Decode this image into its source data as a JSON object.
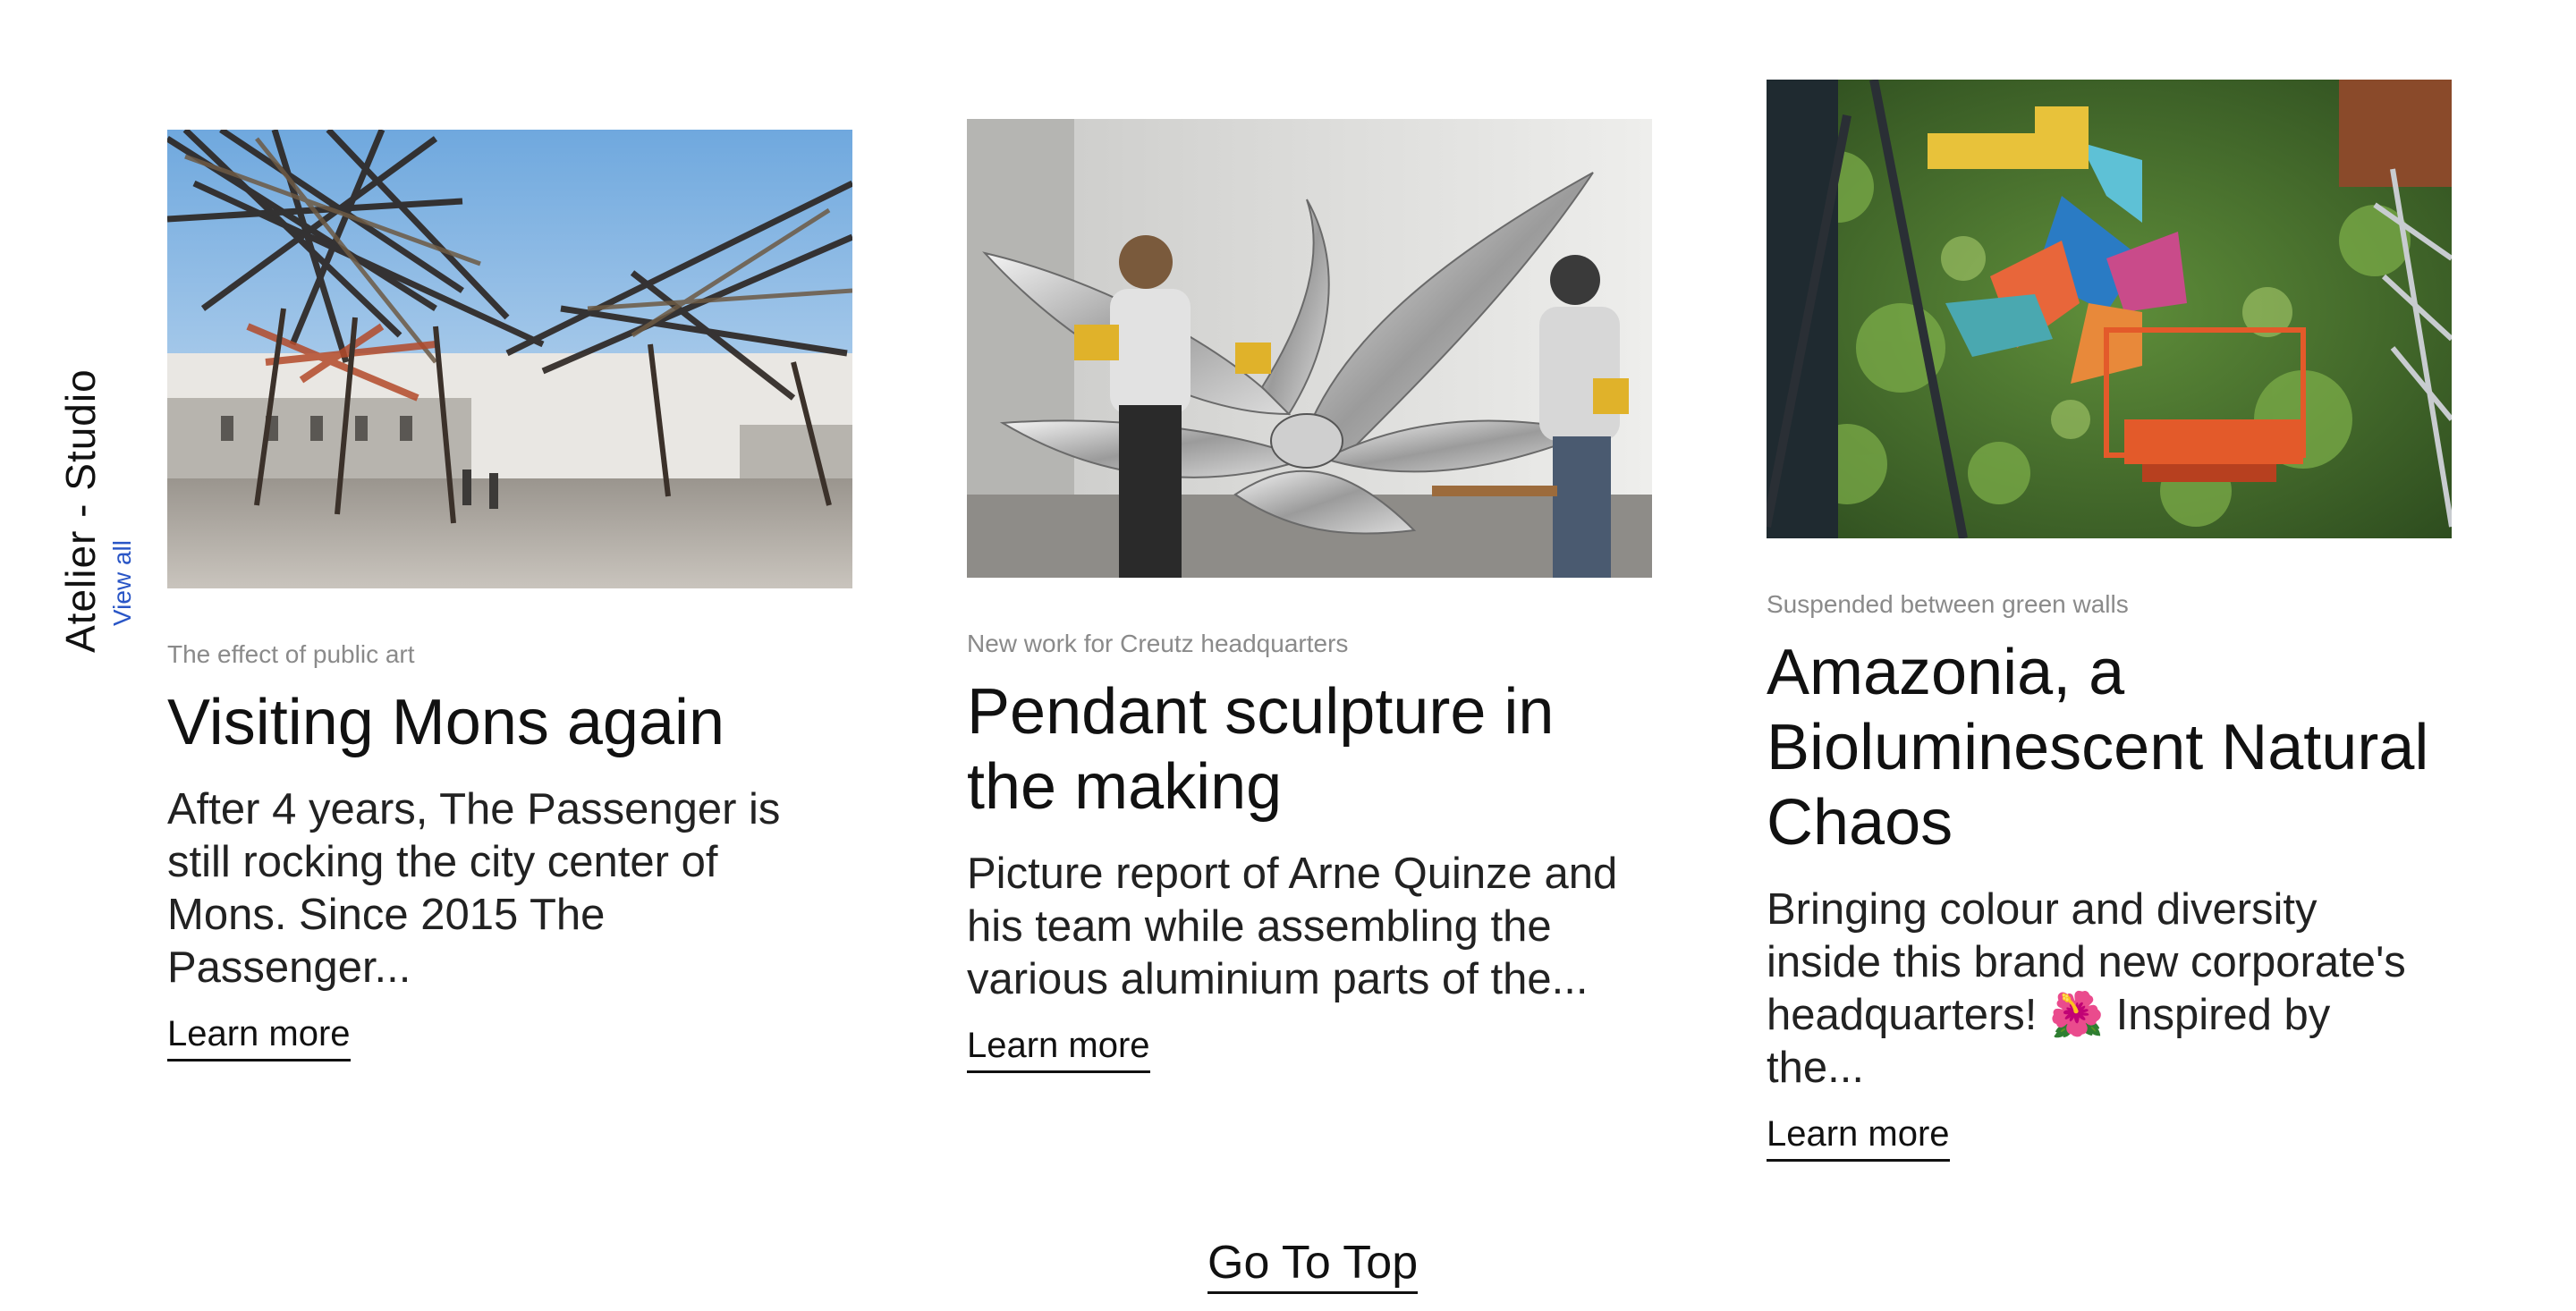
{
  "section": {
    "title": "Atelier - Studio",
    "view_all": "View all"
  },
  "cards": [
    {
      "eyebrow": "The effect of public art",
      "title": "Visiting Mons again",
      "excerpt": "After 4 years, The Passenger is still rocking the city center of Mons. Since 2015 The Passenger...",
      "link": "Learn more",
      "image_subject": "wooden sculpture arching over a cobbled city street"
    },
    {
      "eyebrow": "New work for Creutz headquarters",
      "title": "Pendant sculpture in the making",
      "excerpt": "Picture report of Arne Quinze and his team while assembling the various aluminium parts of the...",
      "link": "Learn more",
      "image_subject": "two workers assembling a large aluminium sculpture in a workshop"
    },
    {
      "eyebrow": "Suspended between green walls",
      "title": "Amazonia, a Bioluminescent Natural Chaos",
      "excerpt": "Bringing colour and diversity inside this brand new corporate's headquarters! 🌺 Inspired by the...",
      "link": "Learn more",
      "image_subject": "colourful suspended sculpture between green plant walls with lifts"
    }
  ],
  "footer": {
    "go_top": "Go To Top"
  },
  "colors": {
    "link_blue": "#2a56c6",
    "text": "#111111",
    "eyebrow_gray": "#8a8a8a"
  }
}
